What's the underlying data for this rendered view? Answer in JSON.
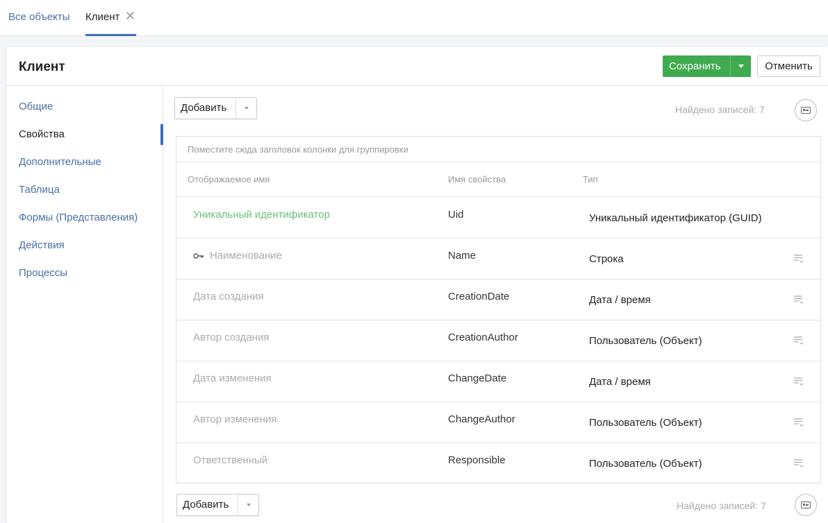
{
  "tabs": {
    "all_objects": "Все объекты",
    "client": "Клиент"
  },
  "header": {
    "title": "Клиент",
    "save_label": "Сохранить",
    "cancel_label": "Отменить"
  },
  "sidebar": {
    "items": [
      {
        "label": "Общие",
        "active": false
      },
      {
        "label": "Свойства",
        "active": true
      },
      {
        "label": "Дополнительные",
        "active": false
      },
      {
        "label": "Таблица",
        "active": false
      },
      {
        "label": "Формы (Представления)",
        "active": false
      },
      {
        "label": "Действия",
        "active": false
      },
      {
        "label": "Процессы",
        "active": false
      }
    ]
  },
  "toolbar": {
    "add_label": "Добавить",
    "found_text": "Найдено записей: 7"
  },
  "grid": {
    "group_panel_hint": "Поместите сюда заголовок колонки для группировки",
    "columns": {
      "display_name": "Отображаемое имя",
      "property_name": "Имя свойства",
      "type": "Тип"
    },
    "rows": [
      {
        "display_name": "Уникальный идентификатор",
        "property_name": "Uid",
        "type": "Уникальный идентификатор (GUID)",
        "primary": true,
        "key": false,
        "menu": false
      },
      {
        "display_name": "Наименование",
        "property_name": "Name",
        "type": "Строка",
        "primary": false,
        "key": true,
        "menu": true
      },
      {
        "display_name": "Дата создания",
        "property_name": "CreationDate",
        "type": "Дата / время",
        "primary": false,
        "key": false,
        "menu": true
      },
      {
        "display_name": "Автор создания",
        "property_name": "CreationAuthor",
        "type": "Пользователь (Объект)",
        "primary": false,
        "key": false,
        "menu": true
      },
      {
        "display_name": "Дата изменения",
        "property_name": "ChangeDate",
        "type": "Дата / время",
        "primary": false,
        "key": false,
        "menu": true
      },
      {
        "display_name": "Автор изменения",
        "property_name": "ChangeAuthor",
        "type": "Пользователь (Объект)",
        "primary": false,
        "key": false,
        "menu": true
      },
      {
        "display_name": "Ответственный",
        "property_name": "Responsible",
        "type": "Пользователь (Объект)",
        "primary": false,
        "key": false,
        "menu": true
      }
    ]
  },
  "icons": {
    "tab_close": "close-icon",
    "key": "key-icon",
    "row_menu": "list-menu-icon",
    "card_view": "card-view-icon"
  },
  "colors": {
    "accent": "#3e6bbf",
    "link": "#4a6fa5",
    "save": "#3faa4f",
    "primary_field": "#6bbf77"
  }
}
